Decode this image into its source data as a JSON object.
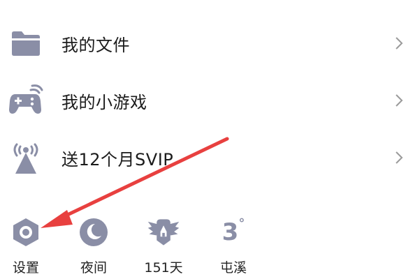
{
  "menu": {
    "items": [
      {
        "label": "我的文件",
        "icon": "folder-icon"
      },
      {
        "label": "我的小游戏",
        "icon": "gamepad-icon"
      },
      {
        "label": "送12个月SVIP",
        "icon": "broadcast-tower-icon"
      }
    ]
  },
  "toolbar": {
    "settings": {
      "label": "设置",
      "icon": "gear-hexagon-icon"
    },
    "night": {
      "label": "夜间",
      "icon": "moon-icon"
    },
    "days": {
      "label": "151天",
      "icon": "winged-badge-icon"
    },
    "weather": {
      "label": "屯溪",
      "temperature": "3",
      "degree_symbol": "°"
    }
  },
  "colors": {
    "icon_gray": "#8a8ea6",
    "arrow_red": "#e8403f",
    "text": "#1b1b1b",
    "chevron": "#9a9a9a"
  }
}
